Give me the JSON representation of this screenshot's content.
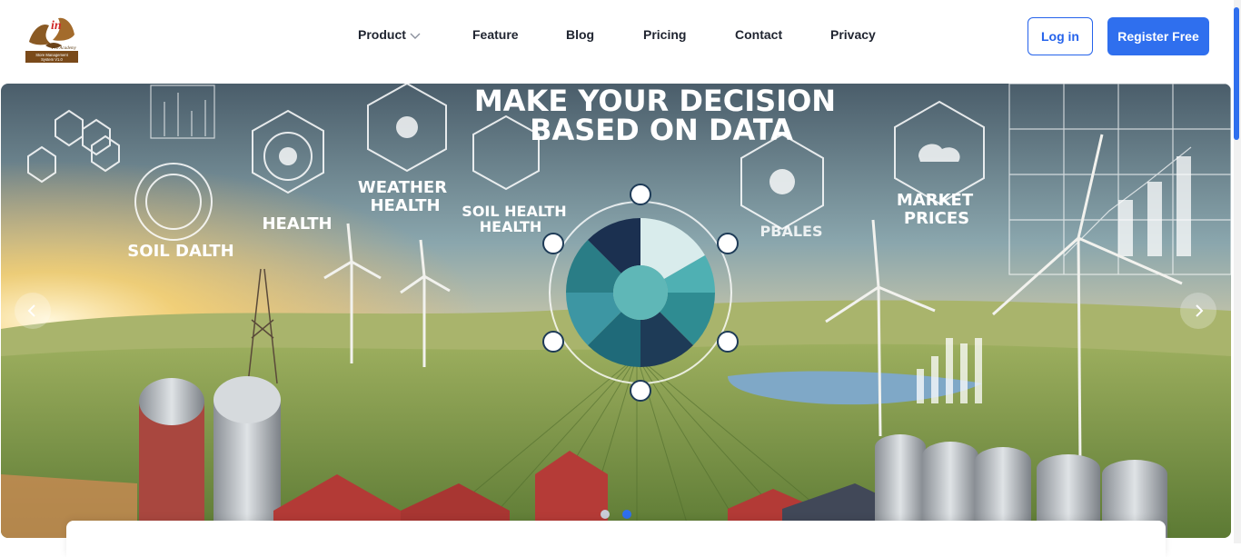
{
  "logo": {
    "icon": "eagle-logo-icon",
    "mark": "in",
    "tagline": "Pro Academy",
    "caption_line1": "Store Management",
    "caption_line2": "System V1.0"
  },
  "nav": {
    "items": [
      {
        "label": "Product",
        "has_dropdown": true
      },
      {
        "label": "Feature"
      },
      {
        "label": "Blog"
      },
      {
        "label": "Pricing"
      },
      {
        "label": "Contact"
      },
      {
        "label": "Privacy"
      }
    ]
  },
  "auth": {
    "login_label": "Log in",
    "register_label": "Register Free"
  },
  "banner": {
    "headline_line1": "MAKE YOUR DECISION",
    "headline_line2": "BASED ON DATA",
    "labels": {
      "soil_dalth": "SOIL DALTH",
      "health": "HEALTH",
      "weather_line1": "WEATHER",
      "weather_line2": "HEALTH",
      "soil_health_line1": "SOIL HEALTH",
      "soil_health_line2": "HEALTH",
      "pbales": "PBALES",
      "market_line1": "MARKET",
      "market_line2": "PRICES"
    },
    "active_slide": 2,
    "slide_count": 2
  },
  "colors": {
    "primary": "#2f6fee",
    "text": "#1f2430",
    "dot_inactive": "#c9cdd8",
    "dot_active": "#2f6fee"
  }
}
